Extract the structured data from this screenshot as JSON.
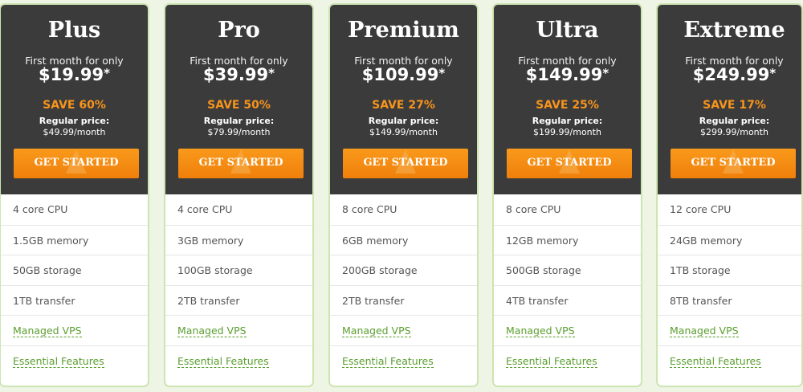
{
  "plans": [
    {
      "name": "Plus",
      "intro": "First month for only",
      "price": "$19.99",
      "asterisk": "*",
      "save": "SAVE 60%",
      "regular_label": "Regular price:",
      "regular_price": "$49.99/month",
      "button": "GET STARTED",
      "features": [
        "4 core CPU",
        "1.5GB memory",
        "50GB storage",
        "1TB transfer"
      ],
      "links": [
        "Managed VPS",
        "Essential Features"
      ]
    },
    {
      "name": "Pro",
      "intro": "First month for only",
      "price": "$39.99",
      "asterisk": "*",
      "save": "SAVE 50%",
      "regular_label": "Regular price:",
      "regular_price": "$79.99/month",
      "button": "GET STARTED",
      "features": [
        "4 core CPU",
        "3GB memory",
        "100GB storage",
        "2TB transfer"
      ],
      "links": [
        "Managed VPS",
        "Essential Features"
      ]
    },
    {
      "name": "Premium",
      "intro": "First month for only",
      "price": "$109.99",
      "asterisk": "*",
      "save": "SAVE 27%",
      "regular_label": "Regular price:",
      "regular_price": "$149.99/month",
      "button": "GET STARTED",
      "features": [
        "8 core CPU",
        "6GB memory",
        "200GB storage",
        "2TB transfer"
      ],
      "links": [
        "Managed VPS",
        "Essential Features"
      ]
    },
    {
      "name": "Ultra",
      "intro": "First month for only",
      "price": "$149.99",
      "asterisk": "*",
      "save": "SAVE 25%",
      "regular_label": "Regular price:",
      "regular_price": "$199.99/month",
      "button": "GET STARTED",
      "features": [
        "8 core CPU",
        "12GB memory",
        "500GB storage",
        "4TB transfer"
      ],
      "links": [
        "Managed VPS",
        "Essential Features"
      ]
    },
    {
      "name": "Extreme",
      "intro": "First month for only",
      "price": "$249.99",
      "asterisk": "*",
      "save": "SAVE 17%",
      "regular_label": "Regular price:",
      "regular_price": "$299.99/month",
      "button": "GET STARTED",
      "features": [
        "12 core CPU",
        "24GB memory",
        "1TB storage",
        "8TB transfer"
      ],
      "links": [
        "Managed VPS",
        "Essential Features"
      ]
    }
  ],
  "colors": {
    "header_bg": "#3b3b3b",
    "accent_orange": "#f7941d",
    "link_green": "#5a9e2e",
    "page_bg": "#eef5e4",
    "card_border": "#cde4b3"
  },
  "icons": {
    "button_decoration": "flame-icon"
  }
}
